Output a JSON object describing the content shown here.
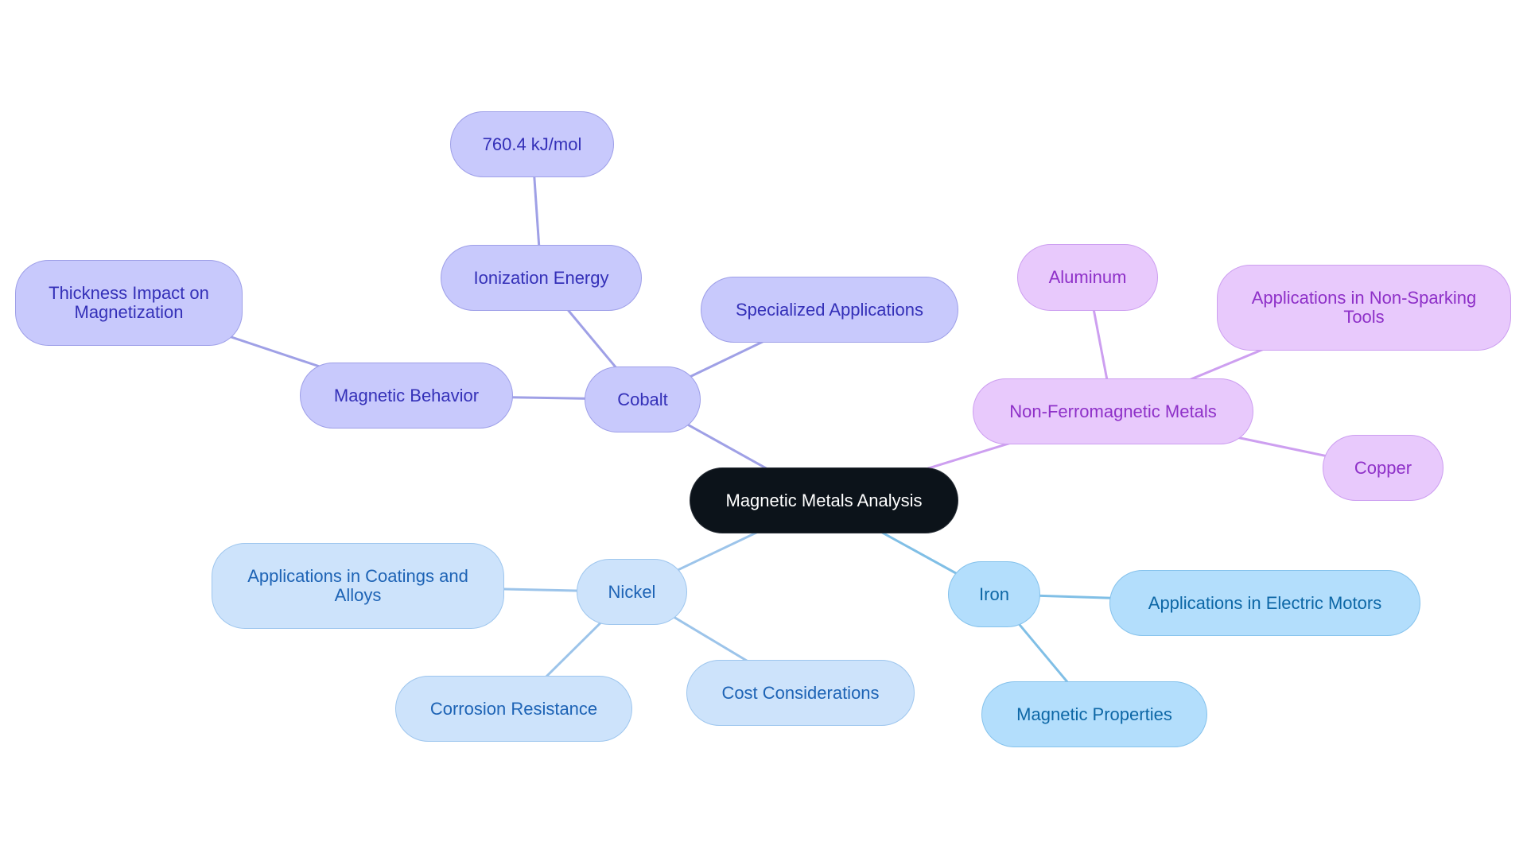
{
  "title": "Magnetic Metals Analysis",
  "colors": {
    "root_fill": "#0c131a",
    "cobalt_branch": "#c8c9fc",
    "cobalt_edge": "#9fa0e6",
    "nonferro_branch": "#e8c9fc",
    "nonferro_edge": "#cd9ff0",
    "nickel_branch": "#cde3fb",
    "nickel_edge": "#9cc4ea",
    "iron_branch": "#b3defc",
    "iron_edge": "#80bfe6"
  },
  "nodes": {
    "root": "Magnetic Metals Analysis",
    "cobalt": "Cobalt",
    "ionization_energy": "Ionization Energy",
    "ionization_value": "760.4 kJ/mol",
    "magnetic_behavior": "Magnetic Behavior",
    "thickness_impact": "Thickness Impact on Magnetization",
    "specialized_applications": "Specialized Applications",
    "non_ferromagnetic": "Non-Ferromagnetic Metals",
    "aluminum": "Aluminum",
    "non_sparking_tools": "Applications in Non-Sparking Tools",
    "copper": "Copper",
    "nickel": "Nickel",
    "coatings_alloys": "Applications in Coatings and Alloys",
    "corrosion_resistance": "Corrosion Resistance",
    "cost_considerations": "Cost Considerations",
    "iron": "Iron",
    "electric_motors": "Applications in Electric Motors",
    "magnetic_properties": "Magnetic Properties"
  },
  "edges": [
    {
      "from": "root",
      "to": "cobalt",
      "branch": "cobalt"
    },
    {
      "from": "cobalt",
      "to": "ionization_energy",
      "branch": "cobalt"
    },
    {
      "from": "ionization_energy",
      "to": "ionization_value",
      "branch": "cobalt"
    },
    {
      "from": "cobalt",
      "to": "magnetic_behavior",
      "branch": "cobalt"
    },
    {
      "from": "magnetic_behavior",
      "to": "thickness_impact",
      "branch": "cobalt"
    },
    {
      "from": "cobalt",
      "to": "specialized_applications",
      "branch": "cobalt"
    },
    {
      "from": "root",
      "to": "non_ferromagnetic",
      "branch": "nonferro"
    },
    {
      "from": "non_ferromagnetic",
      "to": "aluminum",
      "branch": "nonferro"
    },
    {
      "from": "non_ferromagnetic",
      "to": "non_sparking_tools",
      "branch": "nonferro"
    },
    {
      "from": "non_ferromagnetic",
      "to": "copper",
      "branch": "nonferro"
    },
    {
      "from": "root",
      "to": "nickel",
      "branch": "nickel"
    },
    {
      "from": "nickel",
      "to": "coatings_alloys",
      "branch": "nickel"
    },
    {
      "from": "nickel",
      "to": "corrosion_resistance",
      "branch": "nickel"
    },
    {
      "from": "nickel",
      "to": "cost_considerations",
      "branch": "nickel"
    },
    {
      "from": "root",
      "to": "iron",
      "branch": "iron"
    },
    {
      "from": "iron",
      "to": "electric_motors",
      "branch": "iron"
    },
    {
      "from": "iron",
      "to": "magnetic_properties",
      "branch": "iron"
    }
  ]
}
